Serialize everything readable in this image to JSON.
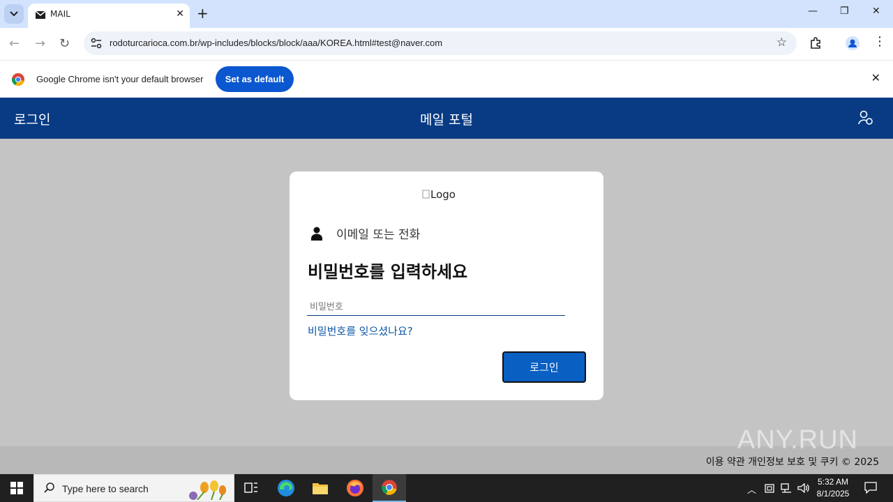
{
  "browser": {
    "tab_title": "MAIL",
    "url": "rodoturcarioca.com.br/wp-includes/blocks/block/aaa/KOREA.html#test@naver.com",
    "infobar_message": "Google Chrome isn't your default browser",
    "infobar_button": "Set as default"
  },
  "header": {
    "left_title": "로그인",
    "center_title": "메일 포털"
  },
  "card": {
    "logo_alt": "Logo",
    "identity_text": "이메일 또는 전화",
    "heading": "비밀번호를 입력하세요",
    "password_placeholder": "비밀번호",
    "forgot_link": "비밀번호를 잊으셨나요?",
    "login_button": "로그인"
  },
  "footer": {
    "copyright": "이용 약관 개인정보 보호 및 쿠키 © 2025"
  },
  "watermark": "ANY.RUN",
  "taskbar": {
    "search_placeholder": "Type here to search",
    "time": "5:32 AM",
    "date": "8/1/2025"
  },
  "colors": {
    "header_bg": "#083b84",
    "primary_button": "#0a5fc2",
    "chrome_blue": "#0b57d0"
  }
}
